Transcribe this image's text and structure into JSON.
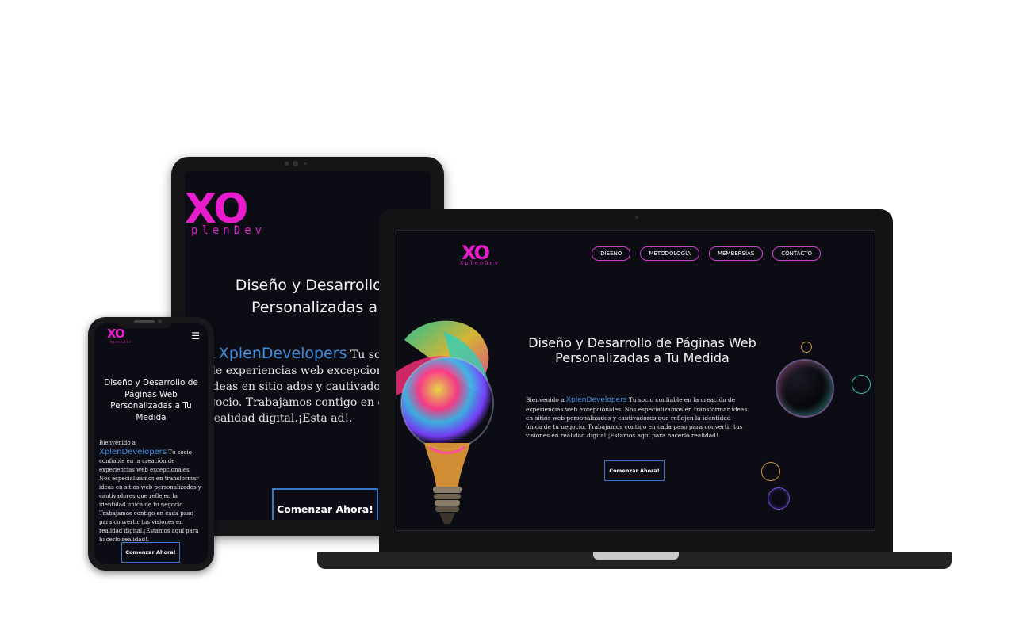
{
  "site": {
    "logo_mark": "XO",
    "logo_text": "XplenDev",
    "nav": [
      "DISEÑO",
      "METODOLOGÍA",
      "MEMBERSÍAS",
      "CONTACTO"
    ],
    "hero_title": "Diseño y Desarrollo de Páginas Web Personalizadas a Tu Medida",
    "intro_prefix": "Bienvenido a ",
    "brand_name": "XplenDevelopers",
    "intro_body": " Tu socio confiable en la creación de experiencias web excepcionales. Nos especializamos en transformar ideas en sitios web personalizados y cautivadores que reflejen la identidad única de tu negocio. Trabajamos contigo en cada paso para convertir tus visiones en realidad digital.¡Estamos aquí para hacerlo realidad!.",
    "cta_label": "Comenzar Ahora!",
    "menu_icon": "☰"
  },
  "tablet_view": {
    "logo_text": "plenDev",
    "title_line1": "Diseño y Desarrollo de Págin",
    "title_line2": "Personalizadas a Tu Med",
    "text_line1_prefix": "a ",
    "text_line1_brand": "XplenDevelopers",
    "text_line1_tail": " Tu soc",
    "text_rest": "de experiencias web excepcional mos en transformar ideas en sitio ados y cautivadores que reflejen la gocio. Trabajamos contigo en cada pa us visiones en realidad digital.¡Esta ad!."
  },
  "colors": {
    "background": "#0c0d14",
    "accent_pink": "#e81ccd",
    "brand_blue": "#3a8de0",
    "cta_border": "#3a78c8"
  }
}
